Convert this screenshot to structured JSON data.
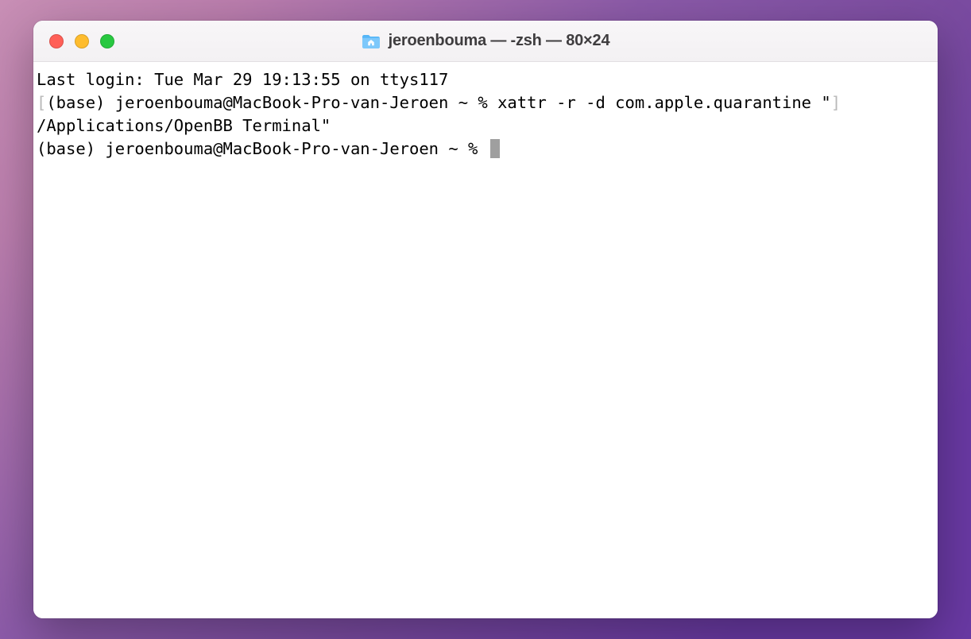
{
  "window": {
    "title": "jeroenbouma — -zsh — 80×24"
  },
  "terminal": {
    "last_login": "Last login: Tue Mar 29 19:13:55 on ttys117",
    "bracket_open": "[",
    "bracket_close": "]",
    "prompt1_text": "(base) jeroenbouma@MacBook-Pro-van-Jeroen ~ % ",
    "command1": "xattr -r -d com.apple.quarantine \"",
    "command_continuation": "/Applications/OpenBB Terminal\"",
    "prompt2_text": "(base) jeroenbouma@MacBook-Pro-van-Jeroen ~ % "
  }
}
